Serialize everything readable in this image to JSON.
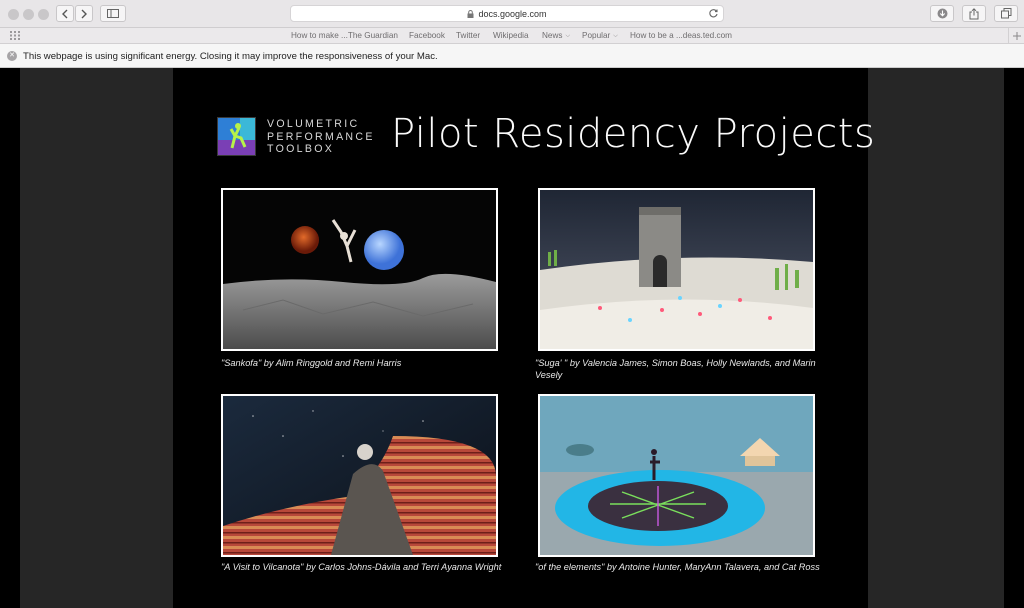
{
  "browser": {
    "url": "docs.google.com",
    "favorites": [
      {
        "label": "How to make ...The Guardian",
        "has_chevron": false
      },
      {
        "label": "Facebook",
        "has_chevron": false
      },
      {
        "label": "Twitter",
        "has_chevron": false
      },
      {
        "label": "Wikipedia",
        "has_chevron": false
      },
      {
        "label": "News",
        "has_chevron": true
      },
      {
        "label": "Popular",
        "has_chevron": true
      },
      {
        "label": "How to be a ...deas.ted.com",
        "has_chevron": false
      }
    ],
    "energy_warning": "This webpage is using significant energy. Closing it may improve the responsiveness of your Mac."
  },
  "slide": {
    "brand_lines": [
      "VOLUMETRIC",
      "PERFORMANCE",
      "TOOLBOX"
    ],
    "title": "Pilot Residency Projects",
    "projects": [
      {
        "caption": "\"Sankofa\" by Alim Ringgold and Remi Harris"
      },
      {
        "caption": "\"Suga' \" by Valencia James, Simon Boas, Holly Newlands, and Marin Vesely"
      },
      {
        "caption": "\"A Visit to Vilcanota\" by Carlos Johns-Dávila and Terri Ayanna Wright"
      },
      {
        "caption": "\"of the elements\" by Antoine Hunter, MaryAnn Talavera, and Cat Ross"
      }
    ]
  },
  "icons": [
    "back-icon",
    "forward-icon",
    "sidebar-icon",
    "lock-icon",
    "reload-icon",
    "download-icon",
    "share-icon",
    "tabs-icon",
    "grid-icon",
    "new-tab-icon",
    "close-icon"
  ]
}
